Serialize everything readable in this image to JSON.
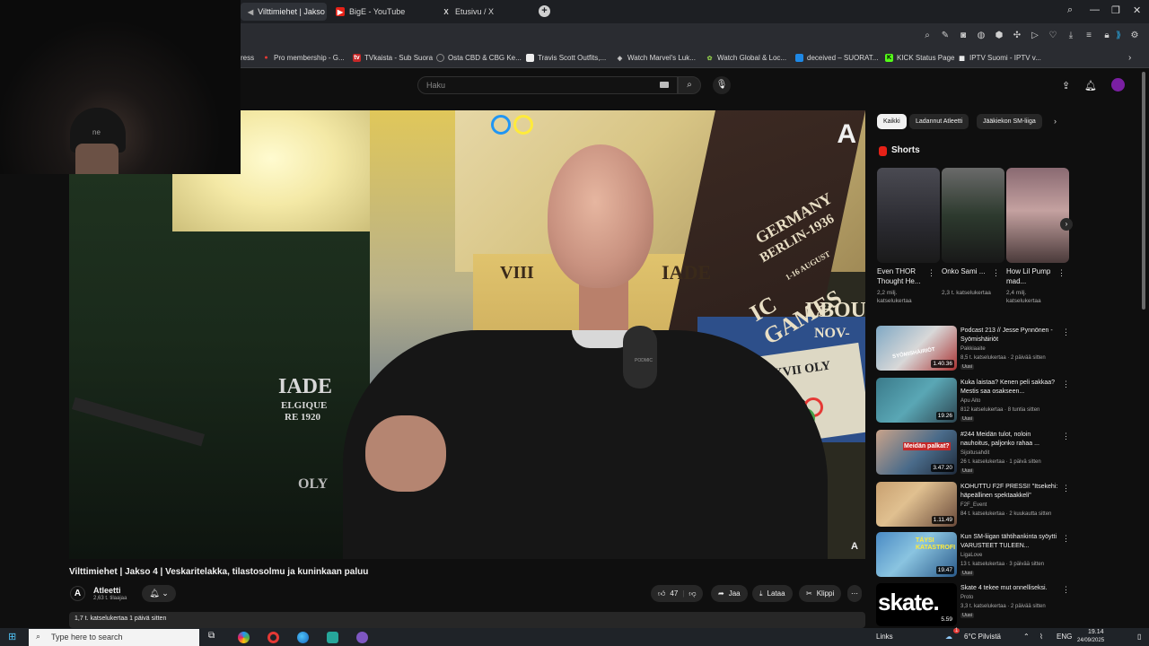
{
  "browser": {
    "tabs": [
      {
        "label": "Vilttimiehet | Jakso 4 |"
      },
      {
        "label": "BigE - YouTube"
      },
      {
        "label": "Etusivu / X"
      }
    ],
    "new_tab": "+",
    "bookmarks": [
      {
        "label": "ress",
        "icon": ""
      },
      {
        "label": "Pro membership - G...",
        "icon": "pin"
      },
      {
        "label": "TVkaista - Sub Suora",
        "icon": "tv"
      },
      {
        "label": "Osta CBD & CBG Ke...",
        "icon": "circle"
      },
      {
        "label": "Travis Scott Outfits,...",
        "icon": "square"
      },
      {
        "label": "Watch Marvel's Luk...",
        "icon": "shield"
      },
      {
        "label": "Watch Global & Loc...",
        "icon": "leaf"
      },
      {
        "label": "deceived – SUORAT...",
        "icon": "square-blue"
      },
      {
        "label": "KICK Status Page",
        "icon": "kick"
      },
      {
        "label": "IPTV Suomi - IPTV v...",
        "icon": "grid"
      }
    ]
  },
  "youtube": {
    "search_placeholder": "Haku",
    "video": {
      "title": "Vilttimiehet | Jakso 4 | Veskaritelakka, tilastosolmu ja kuninkaan paluu",
      "channel": "Atleetti",
      "subscribers": "2,63 t. tilaajaa",
      "likes": "47",
      "share": "Jaa",
      "download": "Lataa",
      "clip": "Klippi",
      "description": "1,7 t. katselukertaa  1 päivä sitten",
      "poster_texts": [
        "GERMANY",
        "BERLIN-1936",
        "1-16 AUGUST",
        "IC GAMES",
        "VIII",
        "IADE",
        "DE LA XVII OLY",
        "LBOU",
        "NOV-",
        "IADE",
        "ELGIQUE",
        "RE 1920",
        "OLY",
        "PODMIC"
      ],
      "watermark": "A",
      "webcam_text": "ne"
    },
    "chips": [
      "Kaikki",
      "Ladannut Atleetti",
      "Jääkiekon SM-liiga"
    ],
    "shorts_heading": "Shorts",
    "shorts": [
      {
        "title": "Even THOR Thought He...",
        "views": "2,2 milj. katselukertaa"
      },
      {
        "title": "Onko Sami ...",
        "views": "2,3 t. katselukertaa"
      },
      {
        "title": "How Lil Pump mad...",
        "views": "2,4 milj. katselukertaa"
      }
    ],
    "recommendations": [
      {
        "title": "Podcast 213 // Jesse Pynnönen - Syömishäiriöt",
        "channel": "Pakkiaaite",
        "meta": "8,5 t. katselukertaa  ·  2 päivää sitten",
        "badge": "Uusi",
        "duration": "1.40.36"
      },
      {
        "title": "Kuka laistaa? Kenen peli sakkaa? Mestis saa osakseen...",
        "channel": "Apu Aito",
        "meta": "812 katselukertaa  ·  8 tuntia sitten",
        "badge": "Uusi",
        "duration": "19.26"
      },
      {
        "title": "#244 Meidän tulot, noloin nauhoitus, paljonko rahaa ...",
        "channel": "Sijoitusahdit",
        "meta": "26 t. katselukertaa  ·  1 päivä sitten",
        "badge": "Uusi",
        "duration": "3.47.20"
      },
      {
        "title": "KOHUTTU F2F PRESSI! \"Itsekehi: häpeällinen spektaakkeli\"",
        "channel": "F2F_Event",
        "meta": "84 t. katselukertaa  ·  2 kuukautta sitten",
        "badge": "",
        "duration": "1.11.49"
      },
      {
        "title": "Kun SM-liigan tähtihankinta syöytti VARUSTEET TULEEN...",
        "channel": "LigaLove",
        "meta": "13 t. katselukertaa  ·  3 päivää sitten",
        "badge": "Uusi",
        "duration": "19.47"
      },
      {
        "title": "Skate 4 tekee mut onnelliseksi.",
        "channel": "Proto",
        "meta": "3,3 t. katselukertaa  ·  2 päivää sitten",
        "badge": "Uusi",
        "duration": "5.59"
      }
    ],
    "thumb_texts": [
      "SYÖMISHÄIRIÖT",
      "Meidän palkat?",
      "TÄYSI KATASTROFI",
      "skate."
    ]
  },
  "taskbar": {
    "search_placeholder": "Type here to search",
    "links": "Links",
    "weather": "6°C  Pilvistä",
    "language": "ENG",
    "time": "19.14",
    "date": "24/09/2025",
    "weather_badge": "1"
  },
  "colors": {
    "youtube_red": "#e62117",
    "bg": "#0f0f0f",
    "chip": "#272727"
  }
}
